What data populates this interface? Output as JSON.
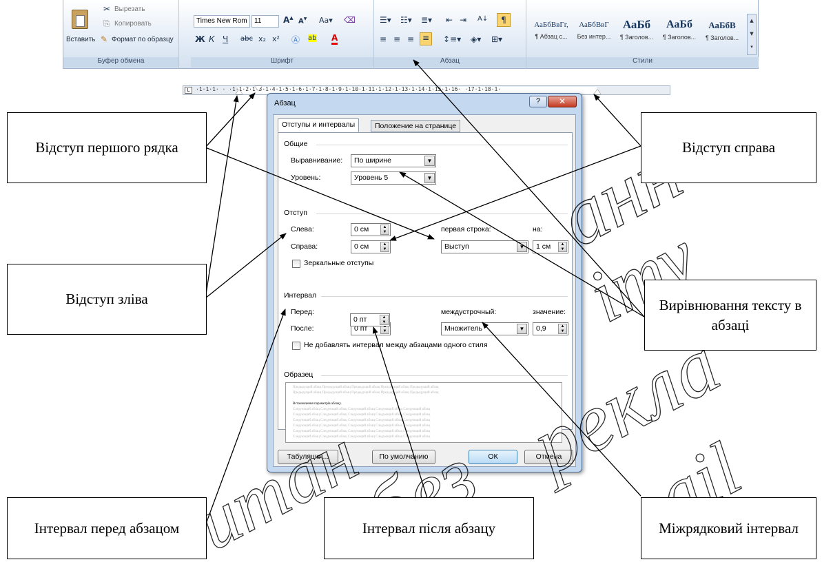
{
  "ribbon": {
    "clipboard": {
      "paste_label": "Вставить",
      "cut_label": "Вырезать",
      "copy_label": "Копировать",
      "format_painter_label": "Формат по образцу",
      "group_title": "Буфер обмена"
    },
    "font": {
      "font_name": "Times New Rom",
      "font_size": "11",
      "group_title": "Шрифт"
    },
    "paragraph": {
      "group_title": "Абзац"
    },
    "styles": {
      "items": [
        {
          "sample": "АаБбВвГг,",
          "name": "¶ Абзац с..."
        },
        {
          "sample": "АаБбВвГ",
          "name": "Без интер..."
        },
        {
          "sample": "АаБб",
          "name": "¶ Заголов..."
        },
        {
          "sample": "АаБб",
          "name": "¶ Заголов..."
        },
        {
          "sample": "АаБбВ",
          "name": "¶ Заголов..."
        }
      ],
      "group_title": "Стили"
    }
  },
  "ruler": {
    "numbers": "·1·1·1·  ·  ·1·1·2·1·3·1·4·1·5·1·6·1·7·1·8·1·9·1·10·1·11·1·12·1·13·1·14·1·15·1·16·  ·17·1·18·1·"
  },
  "dialog": {
    "title": "Абзац",
    "help_label": "?",
    "close_label": "✕",
    "tabs": [
      "Отступы и интервалы",
      "Положение на странице"
    ],
    "general": {
      "section": "Общие",
      "alignment_label": "Выравнивание:",
      "alignment_value": "По ширине",
      "level_label": "Уровень:",
      "level_value": "Уровень 5"
    },
    "indent": {
      "section": "Отступ",
      "left_label": "Слева:",
      "left_value": "0 см",
      "right_label": "Справа:",
      "right_value": "0 см",
      "first_line_label": "первая строка:",
      "first_line_value": "Выступ",
      "by_label": "на:",
      "by_value": "1 см",
      "mirror_label": "Зеркальные отступы"
    },
    "spacing": {
      "section": "Интервал",
      "before_label": "Перед:",
      "before_value": "0 пт",
      "after_label": "После:",
      "after_value": "0 пт",
      "line_label": "междустрочный:",
      "line_value": "Множитель",
      "at_label": "значение:",
      "at_value": "0,9",
      "no_space_label": "Не добавлять интервал между абзацами одного стиля"
    },
    "preview": {
      "section": "Образец",
      "prev_text": "Предыдущий абзац Предыдущий абзац Предыдущий абзац Предыдущий абзац Предыдущий абзац",
      "sample_text": "Встановлення параметрів абзацу.",
      "next_text": "Следующий абзац Следующий абзац Следующий абзац Следующий абзац Следующий абзац"
    },
    "buttons": {
      "tabs_label": "Табуляция...",
      "default_label": "По умолчанию",
      "ok_label": "ОК",
      "cancel_label": "Отмена"
    }
  },
  "callouts": {
    "first_line_indent": "Відступ першого рядка",
    "right_indent": "Відступ справа",
    "left_indent": "Відступ зліва",
    "alignment": "Вирівнювання тексту в абзаці",
    "space_before": "Інтервал перед абзацом",
    "space_after": "Інтервал після абзацу",
    "line_spacing": "Міжрядковий інтервал"
  }
}
